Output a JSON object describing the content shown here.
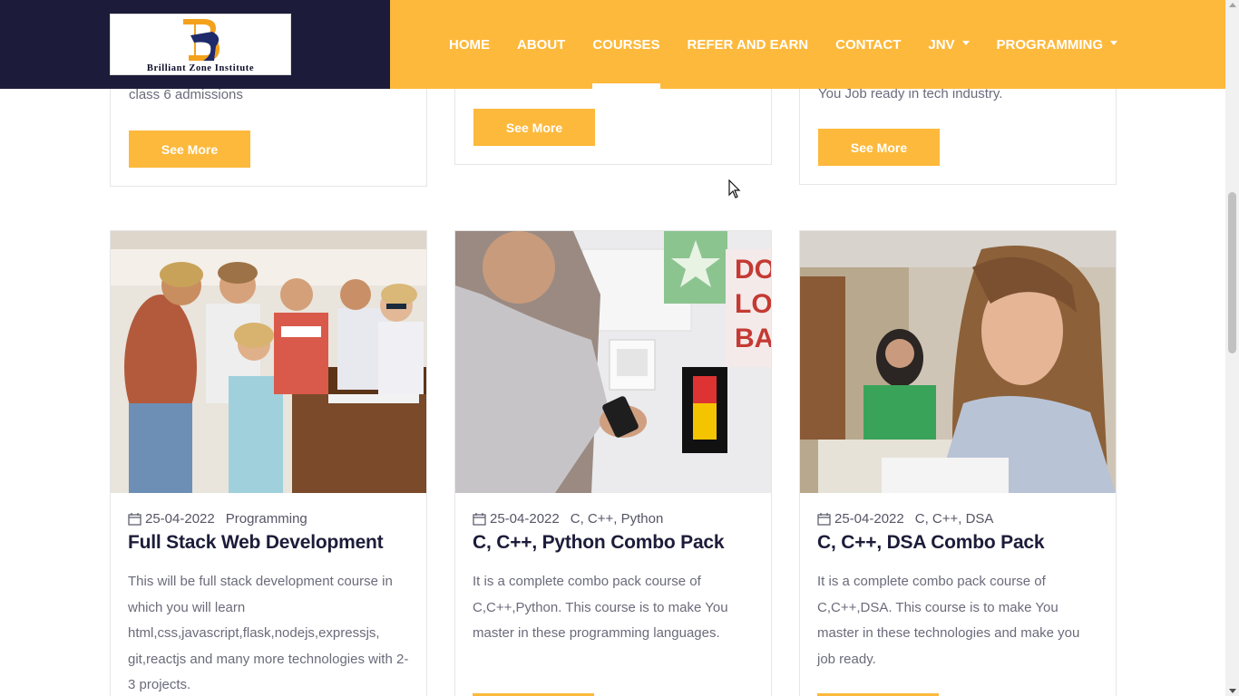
{
  "header": {
    "logo_text": "Brilliant Zone Institute",
    "nav": {
      "home": "HOME",
      "about": "ABOUT",
      "courses": "COURSES",
      "refer": "REFER AND EARN",
      "contact": "CONTACT",
      "jnv": "JNV",
      "programming": "PROGRAMMING"
    },
    "active_item": "COURSES"
  },
  "top_row": [
    {
      "text": "class 6 admissions",
      "button": "See More"
    },
    {
      "text": "",
      "button": "See More"
    },
    {
      "text": "You Job ready in tech industry.",
      "button": "See More"
    }
  ],
  "courses": [
    {
      "date": "25-04-2022",
      "category": "Programming",
      "title": "Full Stack Web Development",
      "description": "This will be full stack development course in which you will learn html,css,javascript,flask,nodejs,expressjs, git,reactjs and many more technologies with 2-3 projects.",
      "image": "students-around-piano-photo"
    },
    {
      "date": "25-04-2022",
      "category": "C, C++, Python",
      "title": "C, C++, Python Combo Pack",
      "description": "It is a complete combo pack course of C,C++,Python. This course is to make You master in these programming languages.",
      "image": "man-with-phone-photo"
    },
    {
      "date": "25-04-2022",
      "category": "C, C++, DSA",
      "title": "C, C++, DSA Combo Pack",
      "description": "It is a complete combo pack course of C,C++,DSA. This course is to make You master in these technologies and make you job ready.",
      "image": "woman-studying-photo"
    }
  ],
  "colors": {
    "accent": "#fdb93c",
    "navy": "#1c1c3a",
    "text": "#6b6b7b"
  }
}
